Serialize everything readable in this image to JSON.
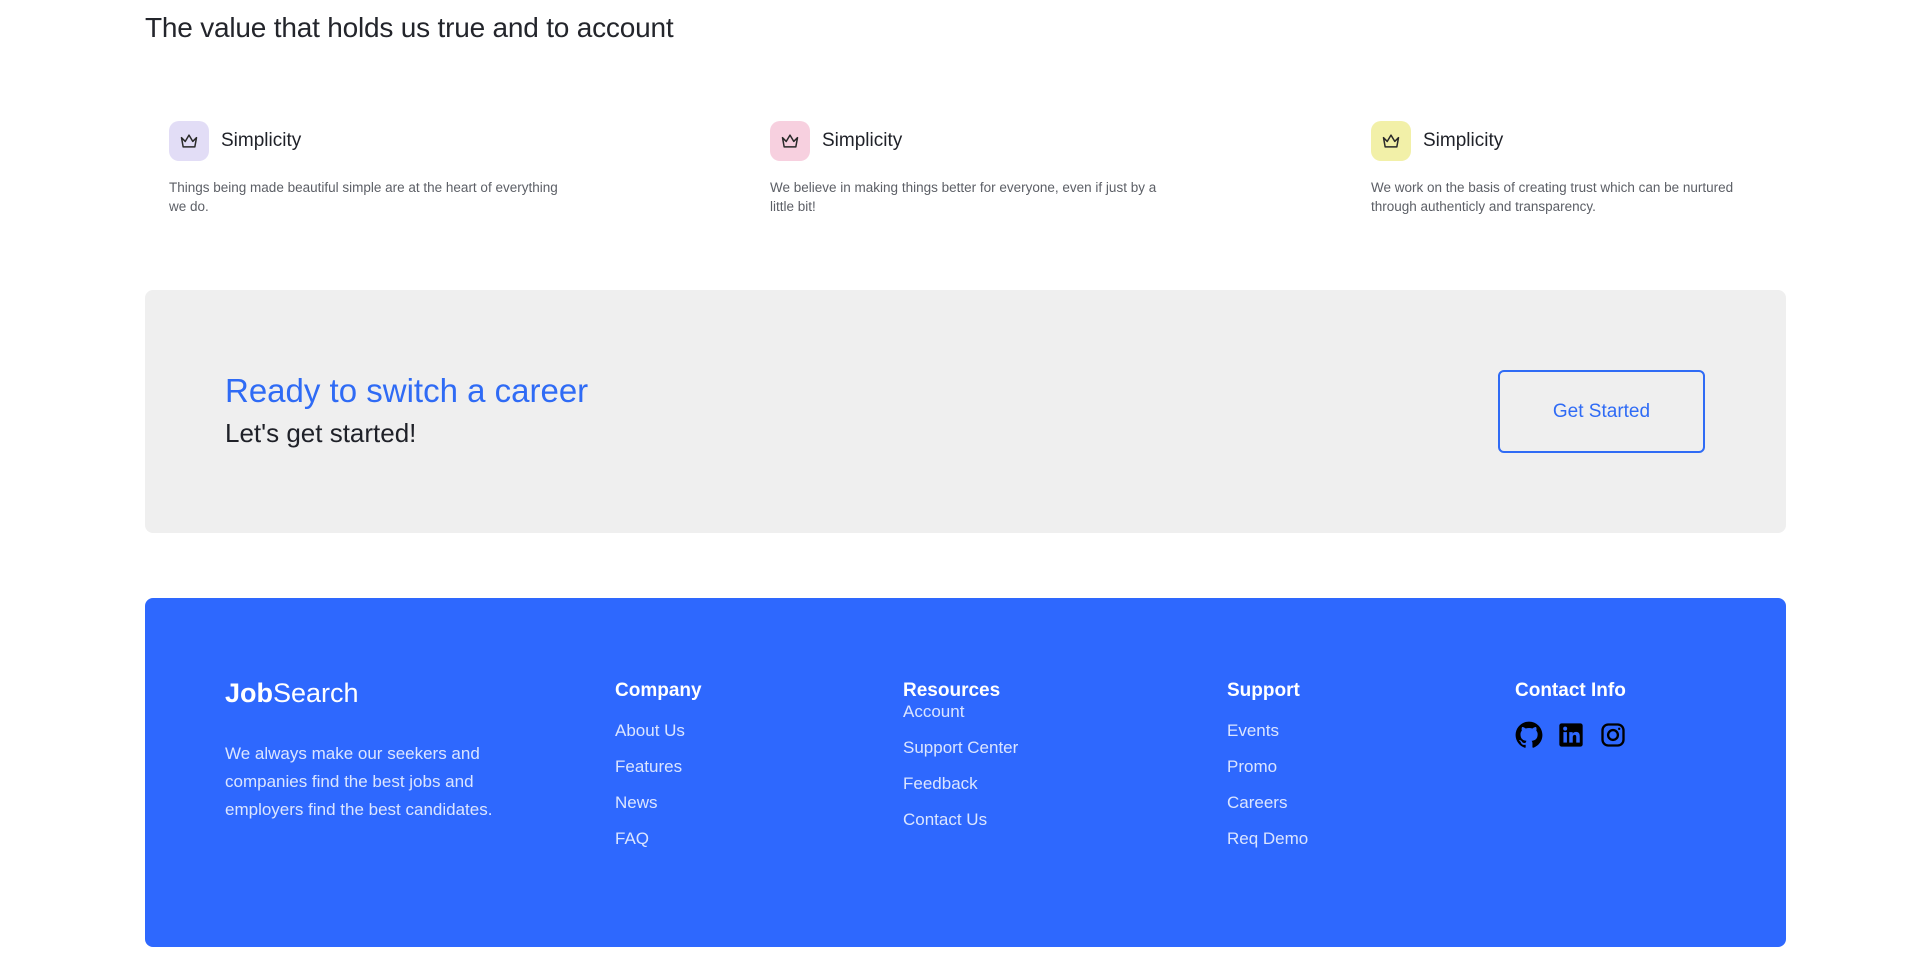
{
  "values": {
    "heading": "The value that holds us true and to account",
    "cards": [
      {
        "title": "Simplicity",
        "description": "Things being made beautiful simple are at the heart of everything we do.",
        "icon": "crown-icon",
        "icon_bg": "#e2ddf6"
      },
      {
        "title": "Simplicity",
        "description": "We believe in making things better for everyone, even if just by a little bit!",
        "icon": "crown-icon",
        "icon_bg": "#f7d0df"
      },
      {
        "title": "Simplicity",
        "description": "We work on the basis of creating trust which can be nurtured through authenticly and transparency.",
        "icon": "crown-icon",
        "icon_bg": "#f2f0a8"
      }
    ]
  },
  "cta": {
    "title": "Ready to switch a career",
    "subtitle": "Let's get started!",
    "button_label": "Get Started"
  },
  "footer": {
    "logo_bold": "Job",
    "logo_regular": "Search",
    "about": "We always make our seekers and companies find the best jobs and employers find the best candidates.",
    "company": {
      "heading": "Company",
      "links": [
        "About Us",
        "Features",
        "News",
        "FAQ"
      ]
    },
    "resources": {
      "heading": "Resources",
      "links": [
        "Account",
        "Support Center",
        "Feedback",
        "Contact Us"
      ]
    },
    "support": {
      "heading": "Support",
      "links": [
        "Events",
        "Promo",
        "Careers",
        "Req Demo"
      ]
    },
    "contact": {
      "heading": "Contact Info",
      "social_icons": [
        "github-icon",
        "linkedin-icon",
        "instagram-icon"
      ]
    }
  },
  "colors": {
    "accent": "#2f6bf5",
    "footer_bg": "#2e68fe",
    "cta_bg": "#efefef"
  }
}
